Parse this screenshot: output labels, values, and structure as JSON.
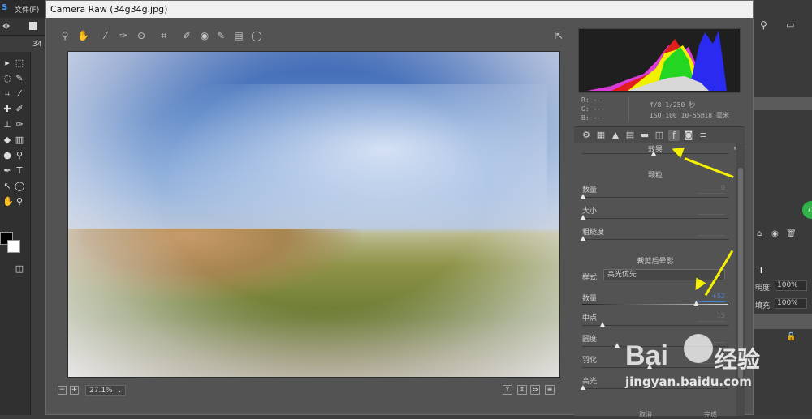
{
  "ps": {
    "menu": [
      "S",
      "文件(F)"
    ],
    "opacity_label": "明度:",
    "opacity_value": "100%",
    "fill_label": "填充:",
    "fill_value": "100%",
    "tab_fragment": "34"
  },
  "dialog": {
    "title": "Camera Raw (34g34g.jpg)"
  },
  "toolbar": {
    "icons": [
      "zoom-icon",
      "hand-icon",
      "white-balance-icon",
      "color-sampler-icon",
      "target-adjust-icon",
      "crop-icon",
      "spot-removal-icon",
      "red-eye-icon",
      "adjustment-brush-icon",
      "graduated-filter-icon",
      "radial-filter-icon",
      "toggle-fullscreen-icon"
    ]
  },
  "zoom": {
    "value": "27.1%",
    "minus": "−",
    "plus": "+"
  },
  "preview_icons": [
    "Y",
    "⇕",
    "⇔",
    "≡"
  ],
  "readout": {
    "r": "R:  ---",
    "g": "G:  ---",
    "b": "B:  ---",
    "exposure": "f/8   1/250 秒",
    "iso": "ISO 100   10-55@18 毫米"
  },
  "panel_tabs": [
    "basic-icon",
    "tone-curve-icon",
    "detail-icon",
    "hsl-icon",
    "split-toning-icon",
    "lens-icon",
    "fx-icon",
    "camera-calibration-icon",
    "presets-icon"
  ],
  "fx": {
    "section_label": "效果",
    "grain": {
      "title": "颗粒",
      "amount_label": "数量",
      "amount_value": "0",
      "size_label": "大小",
      "size_value": "",
      "rough_label": "粗糙度",
      "rough_value": ""
    },
    "vignette": {
      "title": "裁剪后晕影",
      "style_label": "样式",
      "style_value": "高光优先",
      "amount_label": "数量",
      "amount_value": "+52",
      "mid_label": "中点",
      "mid_value": "15",
      "round_label": "圆度",
      "round_value": "",
      "feather_label": "羽化",
      "feather_value": "",
      "highlight_label": "高光",
      "highlight_value": ""
    },
    "amount_level": 0.78
  },
  "buttons": {
    "cancel": "取消",
    "done": "完成"
  },
  "watermark": {
    "brand": "Bai",
    "brand2": "经验",
    "url": "jingyan.baidu.com"
  }
}
